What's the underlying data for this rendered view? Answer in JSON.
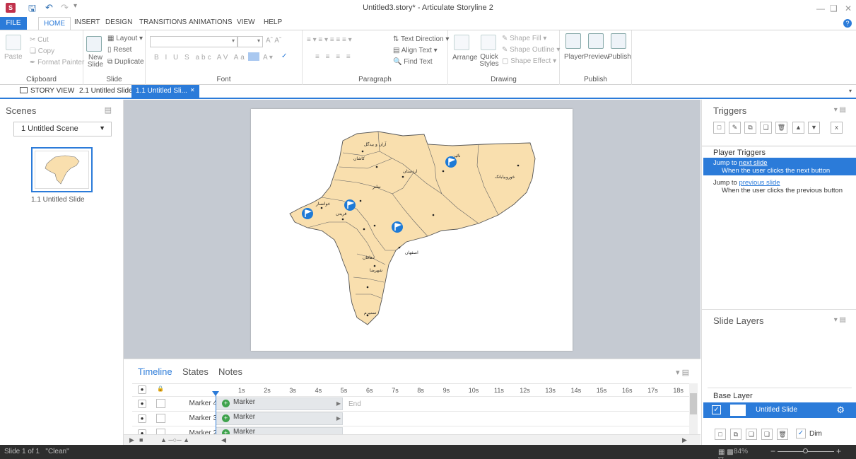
{
  "window": {
    "title": "Untitled3.story* - Articulate Storyline 2"
  },
  "ribbon_tabs": [
    "FILE",
    "HOME",
    "INSERT",
    "DESIGN",
    "TRANSITIONS",
    "ANIMATIONS",
    "VIEW",
    "HELP"
  ],
  "ribbon": {
    "clipboard": {
      "label": "Clipboard",
      "paste": "Paste",
      "cut": "Cut",
      "copy": "Copy",
      "format_painter": "Format Painter"
    },
    "slide": {
      "label": "Slide",
      "new_slide": "New Slide",
      "layout": "Layout",
      "reset": "Reset",
      "duplicate": "Duplicate"
    },
    "font": {
      "label": "Font"
    },
    "paragraph": {
      "label": "Paragraph",
      "text_direction": "Text Direction",
      "align_text": "Align Text",
      "find_text": "Find Text"
    },
    "drawing": {
      "label": "Drawing",
      "arrange": "Arrange",
      "quick_styles": "Quick Styles",
      "shape_fill": "Shape Fill",
      "shape_outline": "Shape Outline",
      "shape_effect": "Shape Effect"
    },
    "publish": {
      "label": "Publish",
      "player": "Player",
      "preview": "Preview",
      "publish": "Publish"
    }
  },
  "doc_tabs": {
    "story_view": "STORY VIEW",
    "tab1": "2.1 Untitled Slide",
    "tab2": "1.1 Untitled Sli..."
  },
  "scenes": {
    "title": "Scenes",
    "selected_scene": "1 Untitled Scene",
    "thumb_label": "1.1 Untitled Slide"
  },
  "timeline": {
    "tabs": [
      "Timeline",
      "States",
      "Notes"
    ],
    "ticks": [
      "1s",
      "2s",
      "3s",
      "4s",
      "5s",
      "6s",
      "7s",
      "8s",
      "9s",
      "10s",
      "11s",
      "12s",
      "13s",
      "14s",
      "15s",
      "16s",
      "17s",
      "18s"
    ],
    "end_label": "End",
    "rows": [
      {
        "name": "Marker 4",
        "bar": "Marker"
      },
      {
        "name": "Marker 3",
        "bar": "Marker"
      },
      {
        "name": "Marker 2",
        "bar": "Marker"
      }
    ]
  },
  "triggers": {
    "title": "Triggers",
    "section": "Player Triggers",
    "items": [
      {
        "prefix": "Jump to ",
        "link": "next slide",
        "sub": "When the user clicks the next button"
      },
      {
        "prefix": "Jump to ",
        "link": "previous slide",
        "sub": "When the user clicks the previous button"
      }
    ]
  },
  "layers": {
    "title": "Slide Layers",
    "base_label": "Base Layer",
    "base_name": "Untitled Slide",
    "dim_label": "Dim"
  },
  "map": {
    "labels": [
      "آران و بیدگل",
      "کاشان",
      "اردستان",
      "نائین",
      "خوروبیابانک",
      "اصفهان",
      "شهرضا",
      "دهاقان",
      "سمیرم",
      "خوانسار",
      "فریدن",
      "نطنز"
    ]
  },
  "statusbar": {
    "slide_info": "Slide 1 of 1",
    "theme": "\"Clean\"",
    "zoom": "84%"
  },
  "colors": {
    "accent": "#2b7bd9",
    "map_fill": "#f9dfae",
    "map_stroke": "#555555"
  }
}
